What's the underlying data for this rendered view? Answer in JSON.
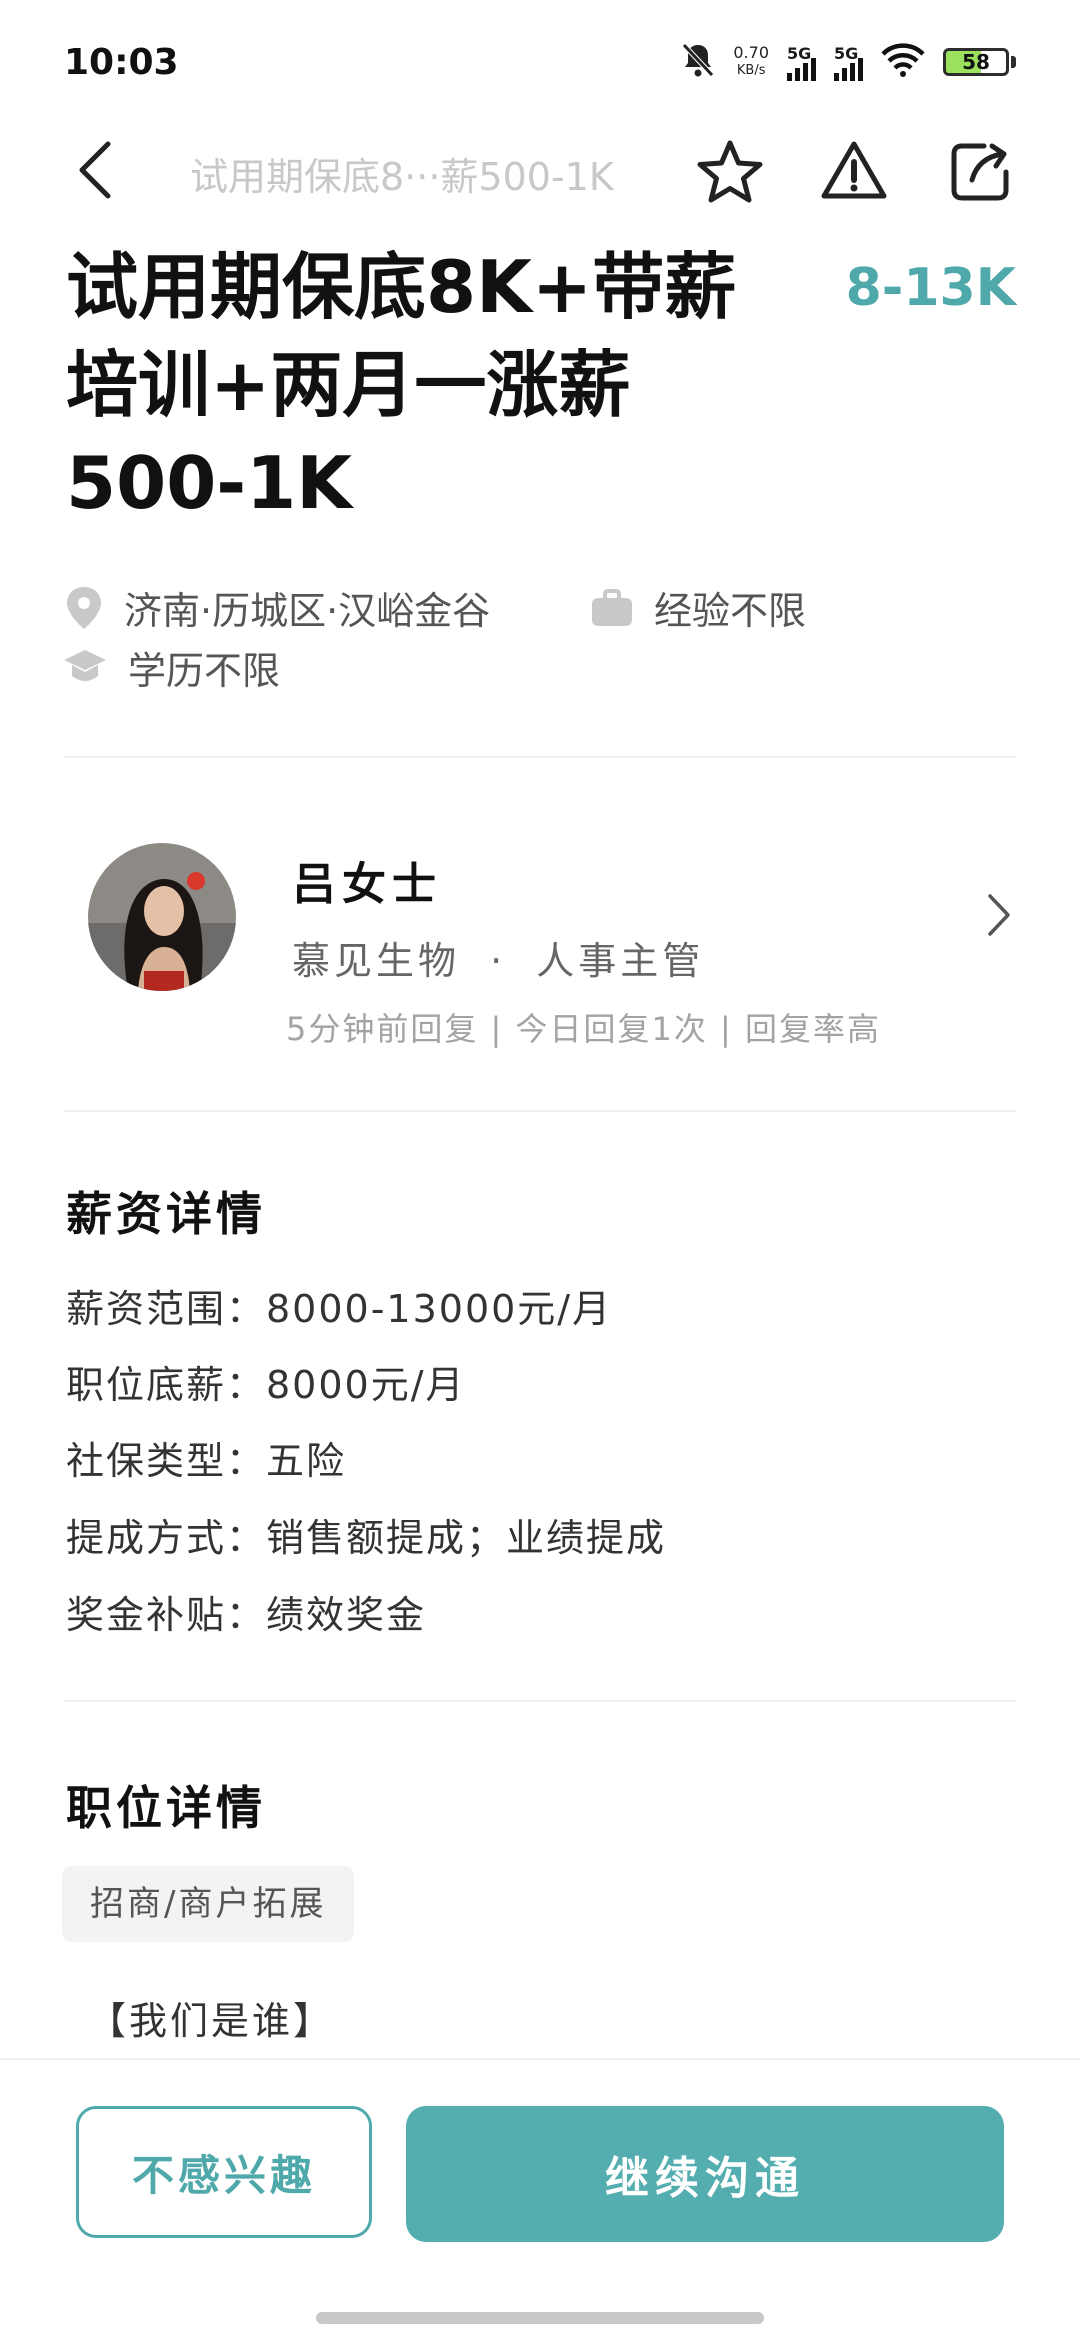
{
  "status_bar": {
    "time": "10:03",
    "speed_value": "0.70",
    "speed_unit": "KB/s",
    "signal1": "5G",
    "signal2": "5G",
    "battery": "58"
  },
  "header": {
    "title": "试用期保底8···薪500-1K"
  },
  "job": {
    "title_line1": "试用期保底8K+带薪",
    "title_line2": "培训+两月一涨薪",
    "title_line3": "500-1K",
    "salary": "8-13K",
    "location": "济南·历城区·汉峪金谷",
    "experience": "经验不限",
    "education": "学历不限"
  },
  "recruiter": {
    "name": "吕女士",
    "company": "慕见生物",
    "separator": "·",
    "role": "人事主管",
    "stats": "5分钟前回复 | 今日回复1次 | 回复率高"
  },
  "salary_section": {
    "title": "薪资详情",
    "lines": [
      "薪资范围：8000-13000元/月",
      "职位底薪：8000元/月",
      "社保类型：五险",
      "提成方式：销售额提成；业绩提成",
      "奖金补贴：绩效奖金"
    ]
  },
  "position_section": {
    "title": "职位详情",
    "tag": "招商/商户拓展",
    "intro": "【我们是谁】"
  },
  "actions": {
    "not_interested": "不感兴趣",
    "continue_chat": "继续沟通"
  },
  "colors": {
    "accent": "#54aeb0",
    "salary": "#4fa9ab"
  }
}
